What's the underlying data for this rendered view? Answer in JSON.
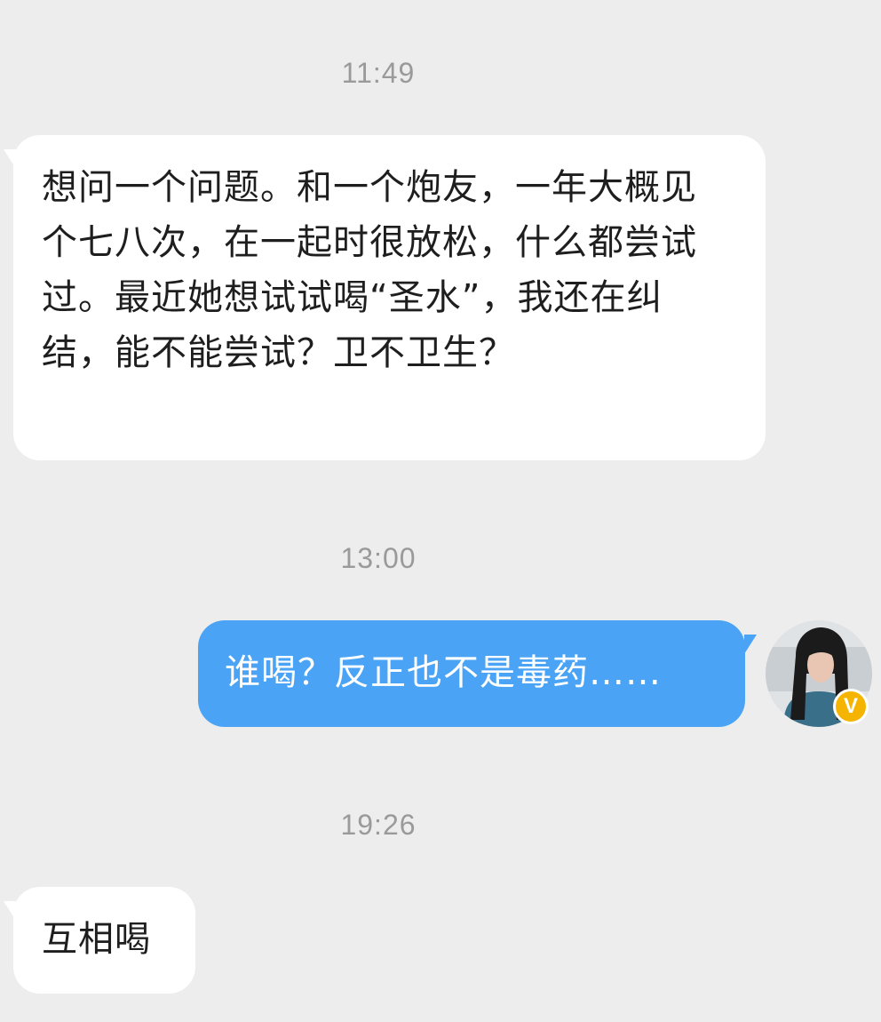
{
  "conversation": {
    "messages": [
      {
        "time": "11:49",
        "side": "left",
        "text": "想问一个问题。和一个炮友，一年大概见个七八次，在一起时很放松，什么都尝试过。最近她想试试喝“圣水”，我还在纠结，能不能尝试？卫不卫生？"
      },
      {
        "time": "13:00",
        "side": "right",
        "text": "谁喝？反正也不是毒药……"
      },
      {
        "time": "19:26",
        "side": "left",
        "text": "互相喝"
      }
    ]
  },
  "avatar": {
    "badge_label": "V",
    "badge_color": "#f5b400"
  },
  "colors": {
    "background": "#ededed",
    "incoming_bubble": "#ffffff",
    "outgoing_bubble": "#4aa3f5",
    "timestamp_text": "#9a9a9a"
  }
}
